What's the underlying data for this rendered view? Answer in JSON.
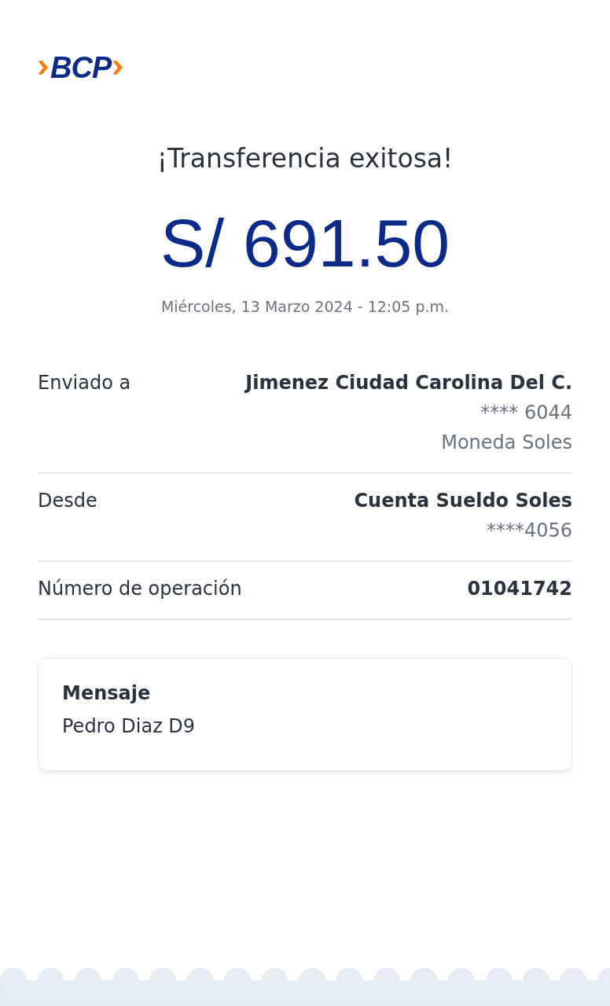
{
  "logo": {
    "text": "BCP"
  },
  "title": "¡Transferencia exitosa!",
  "amount": "S/ 691.50",
  "datetime": "Miércoles, 13 Marzo 2024 - 12:05 p.m.",
  "details": [
    {
      "label": "Enviado a",
      "values": [
        "Jimenez Ciudad Carolina Del C.",
        "**** 6044",
        "Moneda Soles"
      ]
    },
    {
      "label": "Desde",
      "values": [
        "Cuenta Sueldo Soles",
        "****4056"
      ]
    },
    {
      "label": "Número de operación",
      "values": [
        "01041742"
      ]
    }
  ],
  "message": {
    "title": "Mensaje",
    "text": "Pedro Diaz D9"
  }
}
